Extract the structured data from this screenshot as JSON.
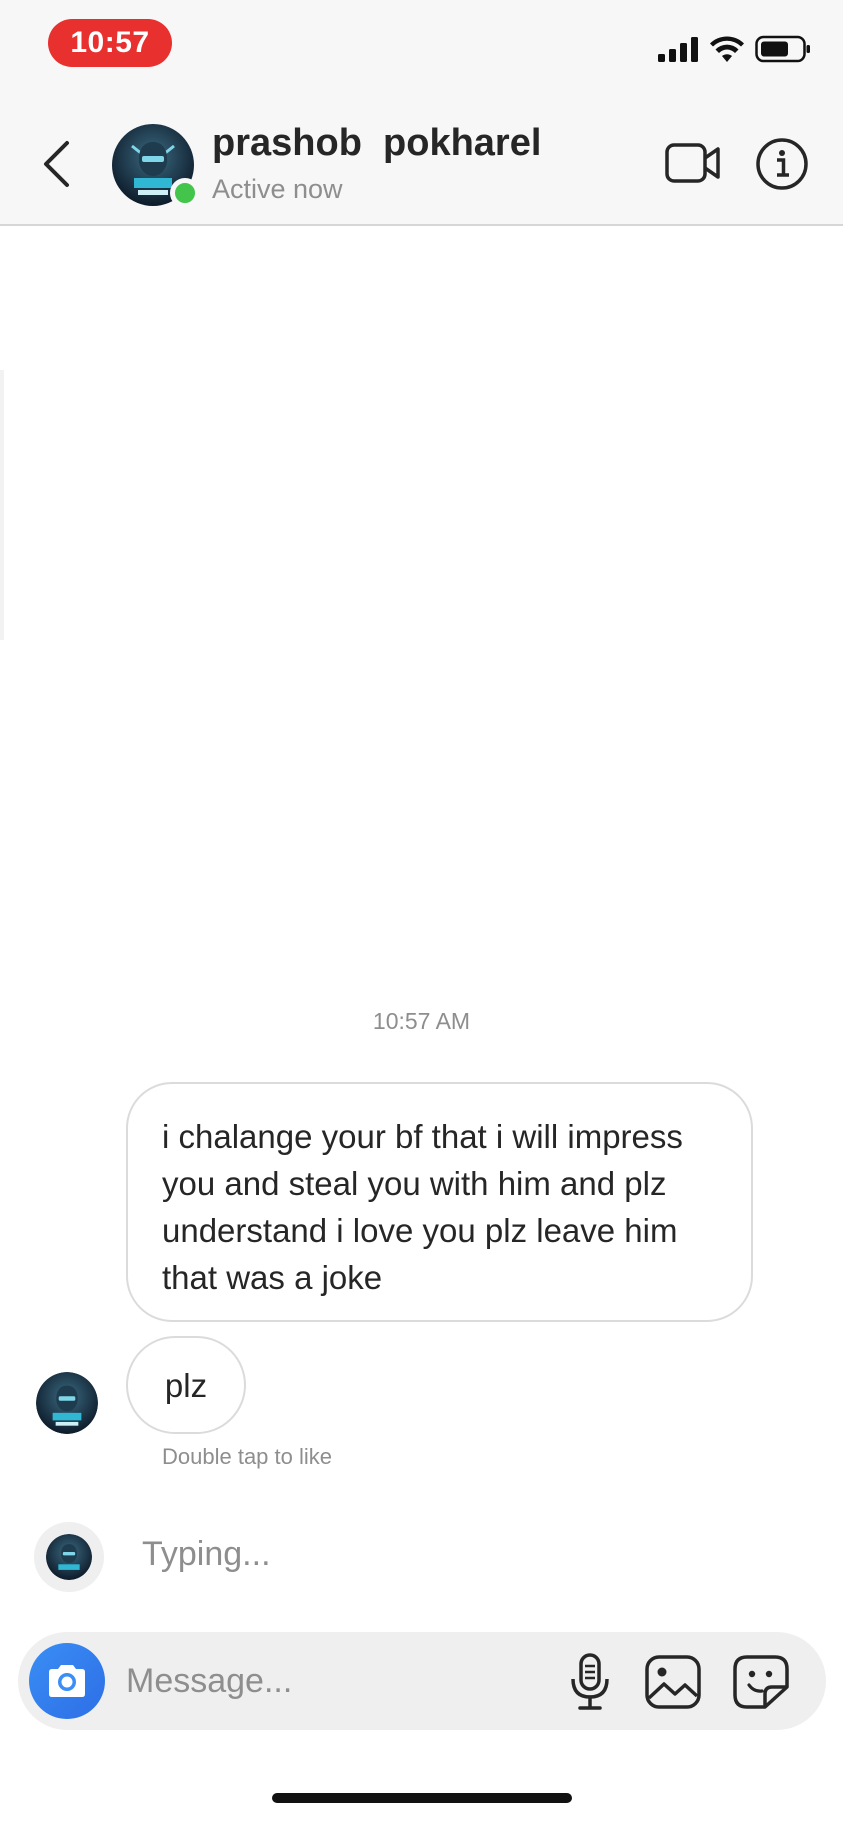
{
  "status_bar": {
    "time": "10:57"
  },
  "header": {
    "name": "prashob  pokharel",
    "status": "Active now",
    "avatar_icon": "ninja-gaming-logo",
    "online_color": "#43c44b"
  },
  "thread": {
    "timestamp": "10:57 AM",
    "messages": [
      {
        "text": "i chalange your bf that i will impress you and steal you with him and plz understand i love you plz leave him that was a joke"
      },
      {
        "text": "plz"
      }
    ],
    "like_hint": "Double tap to like",
    "typing_text": "Typing..."
  },
  "composer": {
    "placeholder": "Message...",
    "accent_color": "#3a8ef5"
  }
}
